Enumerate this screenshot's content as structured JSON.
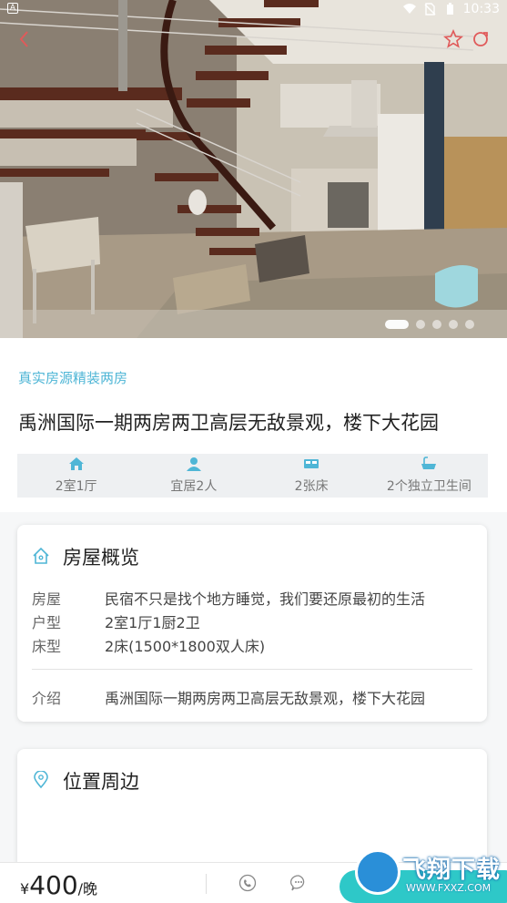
{
  "status_bar": {
    "time": "10:33",
    "left_badge": "A"
  },
  "hero": {
    "slide_count": 5,
    "active_slide": 1
  },
  "listing": {
    "tag": "真实房源精装两房",
    "title": "禹洲国际一期两房两卫高层无敌景观，楼下大花园",
    "features": [
      {
        "icon": "house-icon",
        "label": "2室1厅"
      },
      {
        "icon": "people-icon",
        "label": "宜居2人"
      },
      {
        "icon": "bed-icon",
        "label": "2张床"
      },
      {
        "icon": "bathtub-icon",
        "label": "2个独立卫生间"
      }
    ]
  },
  "overview": {
    "title": "房屋概览",
    "rows": [
      {
        "key": "房屋",
        "value": "民宿不只是找个地方睡觉，我们要还原最初的生活"
      },
      {
        "key": "户型",
        "value": "2室1厅1厨2卫"
      },
      {
        "key": "床型",
        "value": "2床(1500*1800双人床)"
      }
    ],
    "intro_key": "介绍",
    "intro_value": "禹洲国际一期两房两卫高层无敌景观，楼下大花园"
  },
  "location": {
    "title": "位置周边"
  },
  "bottom_bar": {
    "currency": "¥",
    "price": "400",
    "unit": "/晚"
  },
  "watermark": {
    "text": "飞翔下载",
    "url": "WWW.FXXZ.COM"
  },
  "colors": {
    "accent": "#4fb6d6",
    "book_button": "#2ec8c8",
    "fav_icon": "#e05a5a"
  }
}
